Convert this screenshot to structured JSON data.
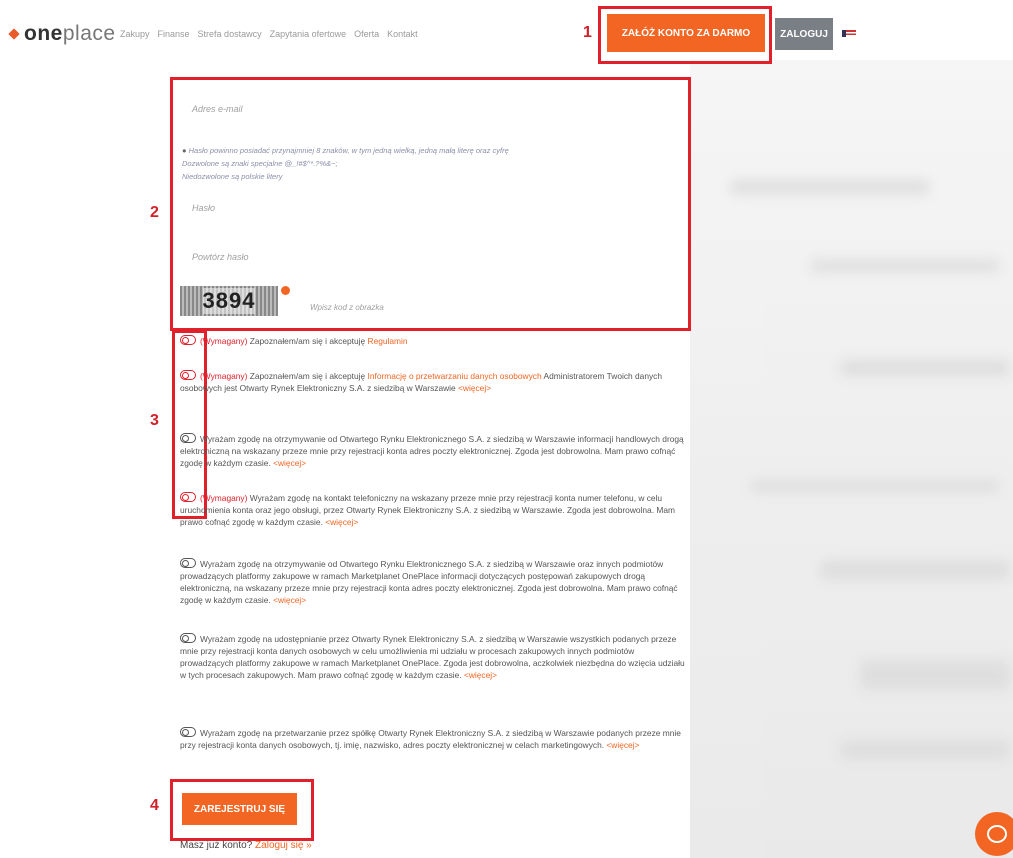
{
  "header": {
    "brand_prefix": "one",
    "brand_suffix": "place",
    "nav": [
      "Zakupy",
      "Finanse",
      "Strefa dostawcy",
      "Zapytania ofertowe",
      "Oferta",
      "Kontakt"
    ],
    "register_label": "ZAŁÓŻ KONTO ZA DARMO",
    "login_label": "ZALOGUJ"
  },
  "annotations": [
    "1",
    "2",
    "3",
    "4"
  ],
  "form": {
    "email_placeholder": "Adres e-mail",
    "hint_1": "Hasło powinno posiadać przynajmniej 8 znaków, w tym jedną wielką, jedną małą literę oraz cyfrę",
    "hint_2": "Dozwolone są znaki specjalne @_!#$^*.?%&~;",
    "hint_3": "Niedozwolone są polskie litery",
    "password_placeholder": "Hasło",
    "repeat_password_placeholder": "Powtórz hasło",
    "captcha_text": "3894",
    "captcha_placeholder": "Wpisz kod z obrazka"
  },
  "consents": [
    {
      "required": "(Wymagany)",
      "text": " Zapoznałem/am się i akceptuję ",
      "link": "Regulamin",
      "more": ""
    },
    {
      "required": "(Wymagany)",
      "text": " Zapoznałem/am się i akceptuję ",
      "link": "Informację o przetwarzaniu danych osobowych",
      "tail": " Administratorem Twoich danych osobowych jest Otwarty Rynek Elektroniczny S.A. z siedzibą w Warszawie ",
      "more": "<więcej>"
    },
    {
      "required": "",
      "text": "Wyrażam zgodę na otrzymywanie od Otwartego Rynku Elektronicznego S.A. z siedzibą w Warszawie informacji handlowych drogą elektroniczną na wskazany przeze mnie przy rejestracji konta adres poczty elektronicznej. Zgoda jest dobrowolna. Mam prawo cofnąć zgodę w każdym czasie. ",
      "more": "<więcej>"
    },
    {
      "required": "(Wymagany)",
      "text": " Wyrażam zgodę na kontakt telefoniczny na wskazany przeze mnie przy rejestracji konta numer telefonu, w celu uruchomienia konta oraz jego obsługi, przez Otwarty Rynek Elektroniczny S.A. z siedzibą w Warszawie. Zgoda jest dobrowolna. Mam prawo cofnąć zgodę w każdym czasie. ",
      "more": "<więcej>"
    },
    {
      "required": "",
      "text": "Wyrażam zgodę na otrzymywanie od Otwartego Rynku Elektronicznego S.A. z siedzibą w Warszawie oraz innych podmiotów prowadzących platformy zakupowe w ramach Marketplanet OnePlace informacji dotyczących postępowań zakupowych drogą elektroniczną, na wskazany przeze mnie przy rejestracji konta adres poczty elektronicznej. Zgoda jest dobrowolna. Mam prawo cofnąć zgodę w każdym czasie. ",
      "more": "<więcej>"
    },
    {
      "required": "",
      "text": "Wyrażam zgodę na udostępnianie przez Otwarty Rynek Elektroniczny S.A. z siedzibą w Warszawie wszystkich podanych przeze mnie przy rejestracji konta danych osobowych w celu umożliwienia mi udziału w procesach zakupowych innych podmiotów prowadzących platformy zakupowe w ramach Marketplanet OnePlace. Zgoda jest dobrowolna, aczkolwiek niezbędna do wzięcia udziału w tych procesach zakupowych. Mam prawo cofnąć zgodę w każdym czasie. ",
      "more": "<więcej>"
    },
    {
      "required": "",
      "text": "Wyrażam zgodę na przetwarzanie przez spółkę Otwarty Rynek Elektroniczny S.A. z siedzibą w Warszawie podanych przeze mnie przy rejestracji konta danych osobowych, tj. imię, nazwisko, adres poczty elektronicznej w celach marketingowych. ",
      "more": "<więcej>"
    }
  ],
  "submit_label": "ZAREJESTRUJ SIĘ",
  "footer": {
    "question": "Masz już konto? ",
    "login_link": "Zaloguj się »"
  },
  "colors": {
    "accent": "#f26522",
    "annotation": "#e0202b",
    "login_button": "#7a7f86"
  }
}
